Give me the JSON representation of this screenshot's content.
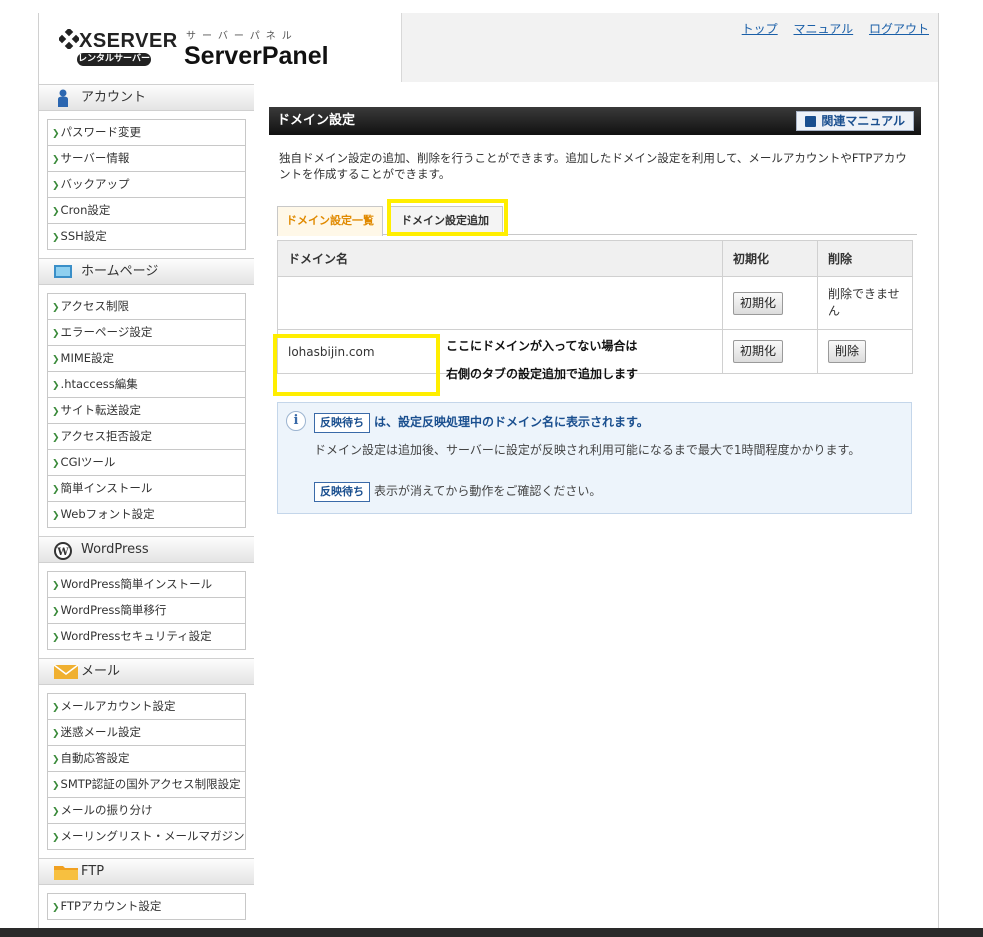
{
  "header": {
    "brand": "XSERVER",
    "brand_badge": "レンタルサーバー",
    "panel_kana": "サーバーパネル",
    "panel_title": "ServerPanel",
    "links": [
      "トップ",
      "マニュアル",
      "ログアウト"
    ]
  },
  "sidebar": [
    {
      "title": "アカウント",
      "icon": "person-icon",
      "items": [
        "パスワード変更",
        "サーバー情報",
        "バックアップ",
        "Cron設定",
        "SSH設定"
      ]
    },
    {
      "title": "ホームページ",
      "icon": "monitor-icon",
      "items": [
        "アクセス制限",
        "エラーページ設定",
        "MIME設定",
        ".htaccess編集",
        "サイト転送設定",
        "アクセス拒否設定",
        "CGIツール",
        "簡単インストール",
        "Webフォント設定"
      ]
    },
    {
      "title": "WordPress",
      "icon": "wordpress-icon",
      "items": [
        "WordPress簡単インストール",
        "WordPress簡単移行",
        "WordPressセキュリティ設定"
      ]
    },
    {
      "title": "メール",
      "icon": "envelope-icon",
      "items": [
        "メールアカウント設定",
        "迷惑メール設定",
        "自動応答設定",
        "SMTP認証の国外アクセス制限設定",
        "メールの振り分け",
        "メーリングリスト・メールマガジン"
      ]
    },
    {
      "title": "FTP",
      "icon": "folder-icon",
      "items": [
        "FTPアカウント設定"
      ]
    }
  ],
  "main": {
    "title": "ドメイン設定",
    "manual_button": "関連マニュアル",
    "description": "独自ドメイン設定の追加、削除を行うことができます。追加したドメイン設定を利用して、メールアカウントやFTPアカウントを作成することができます。",
    "tabs": [
      "ドメイン設定一覧",
      "ドメイン設定追加"
    ],
    "table": {
      "headers": [
        "ドメイン名",
        "初期化",
        "削除"
      ],
      "rows": [
        {
          "domain": "",
          "init": "初期化",
          "delete": "削除できません"
        },
        {
          "domain": "lohasbijin.com",
          "init": "初期化",
          "delete": "削除"
        }
      ]
    },
    "note_lines": [
      "ここにドメインが入ってない場合は",
      "右側のタブの設定追加で追加します"
    ],
    "info": {
      "tag": "反映待ち",
      "line1": "は、設定反映処理中のドメイン名に表示されます。",
      "line2": "ドメイン設定は追加後、サーバーに設定が反映され利用可能になるまで最大で1時間程度かかります。",
      "line3": "表示が消えてから動作をご確認ください。"
    }
  }
}
